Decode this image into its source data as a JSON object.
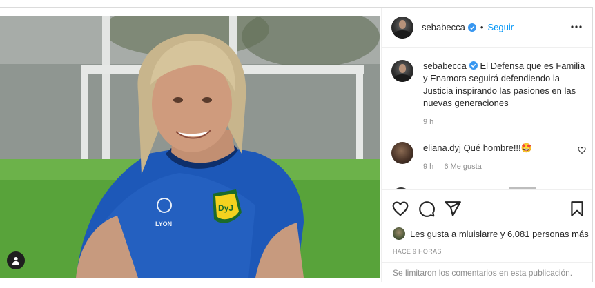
{
  "header": {
    "username": "sebabecca",
    "separator": "•",
    "follow_label": "Seguir",
    "more_label": "Más opciones"
  },
  "caption": {
    "username": "sebabecca",
    "text": "El Defensa que es Familia y Enamora seguirá defendiendo la Justicia inspirando las pasiones en las nuevas generaciones",
    "time": "9 h"
  },
  "comments": [
    {
      "username": "eliana.dyj",
      "text": "Qué hombre!!!🤩",
      "time": "9 h",
      "likes": "6 Me gusta"
    }
  ],
  "likes": {
    "prefix": "Les gusta a ",
    "user": "mluislarre",
    "middle": " y ",
    "count": "6,081 personas más"
  },
  "timestamp": "HACE 9 HORAS",
  "comments_limited": "Se limitaron los comentarios en esta publicación.",
  "colors": {
    "accent": "#0095f6",
    "verified": "#3897f0",
    "secondary_text": "#8e8e8e",
    "border": "#dbdbdb"
  },
  "icons": {
    "like": "heart-icon",
    "comment": "comment-icon",
    "share": "share-icon",
    "save": "bookmark-icon",
    "more": "more-horizontal-icon",
    "user_tag": "user-tag-icon",
    "verified": "verified-badge-icon"
  }
}
